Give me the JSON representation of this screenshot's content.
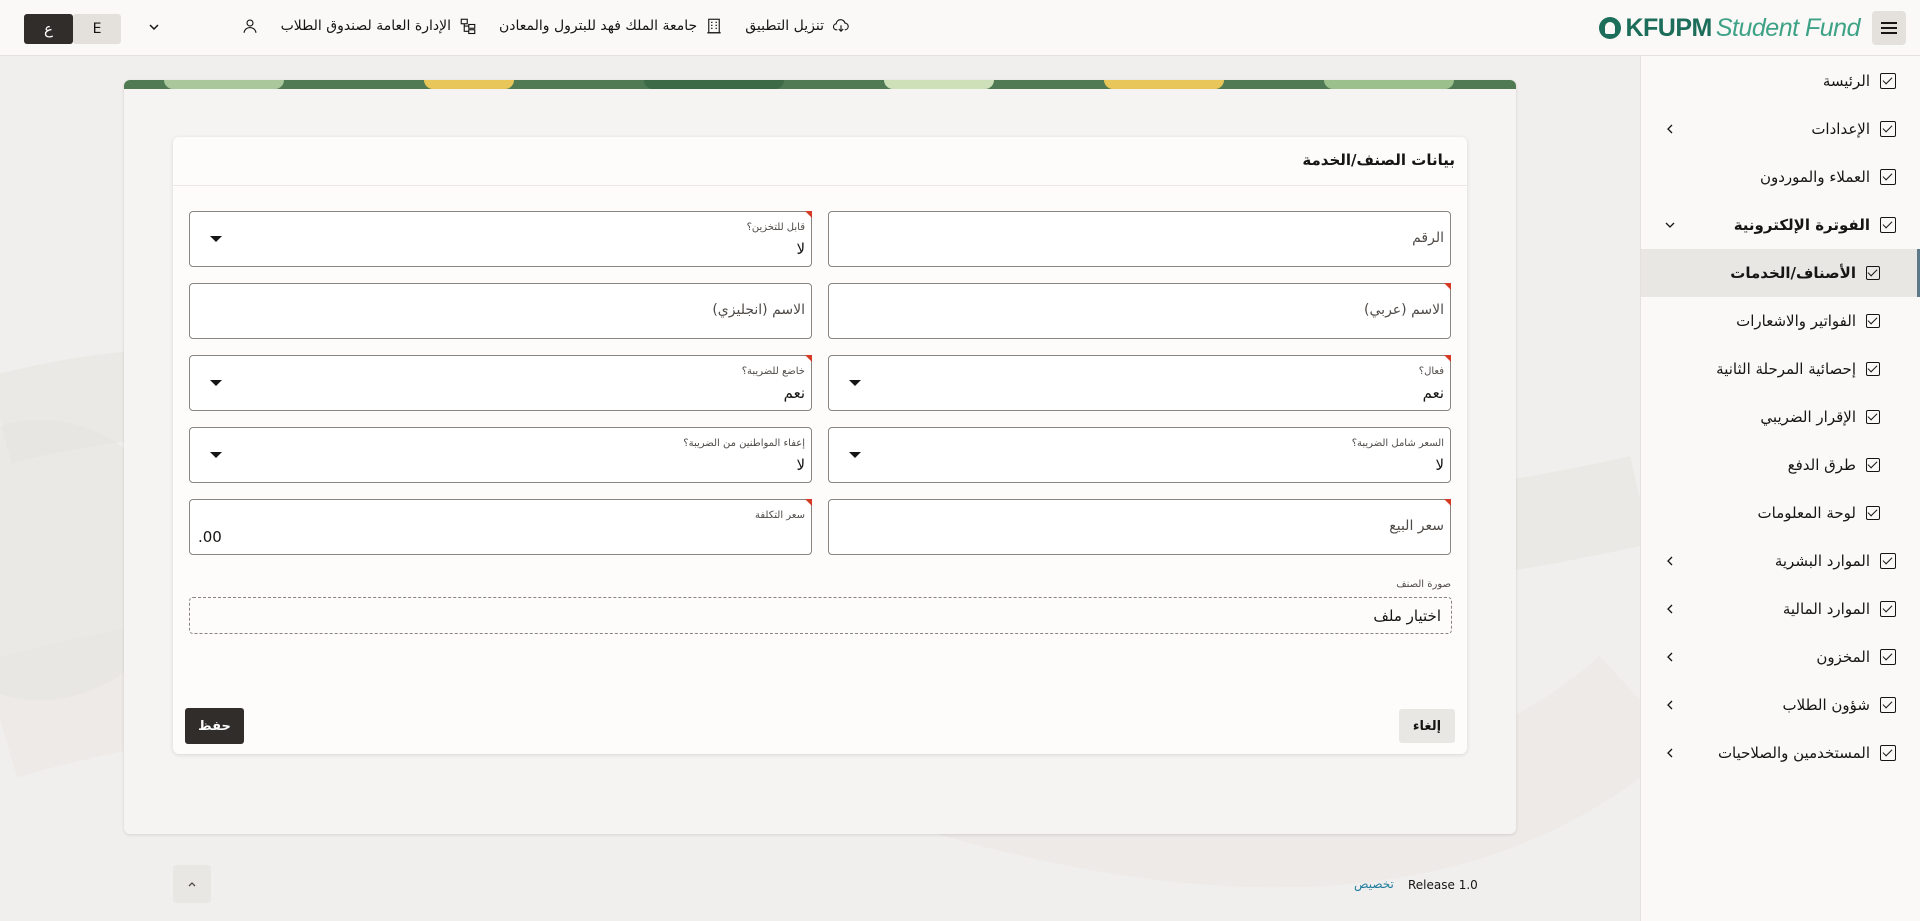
{
  "header": {
    "menu_icon": "hamburger-icon",
    "logo_text_bold": "KFUPM",
    "logo_text_light": "Student Fund",
    "items": [
      {
        "label": "تنزيل التطبيق",
        "icon": "cloud-download-icon"
      },
      {
        "label": "جامعة الملك فهد للبترول والمعادن",
        "icon": "building-icon"
      },
      {
        "label": "الإدارة العامة لصندوق الطلاب",
        "icon": "org-chart-icon"
      }
    ],
    "user_icon": "user-icon",
    "lang_english": "E",
    "lang_arabic": "ع"
  },
  "sidebar": {
    "items": [
      {
        "label": "الرئيسة",
        "sub": false,
        "chevron": false
      },
      {
        "label": "الإعدادات",
        "sub": false,
        "chevron": true
      },
      {
        "label": "العملاء والموردون",
        "sub": false,
        "chevron": false
      },
      {
        "label": "الفوترة الإلكترونية",
        "sub": false,
        "chevron": true,
        "expanded": true
      },
      {
        "label": "الأصناف/الخدمات",
        "sub": true,
        "active": true
      },
      {
        "label": "الفواتير والاشعارات",
        "sub": true
      },
      {
        "label": "إحصائية المرحلة الثانية",
        "sub": true
      },
      {
        "label": "الإقرار الضريبي",
        "sub": true
      },
      {
        "label": "طرق الدفع",
        "sub": true
      },
      {
        "label": "لوحة المعلومات",
        "sub": true
      },
      {
        "label": "الموارد البشرية",
        "sub": false,
        "chevron": true
      },
      {
        "label": "الموارد المالية",
        "sub": false,
        "chevron": true
      },
      {
        "label": "المخزون",
        "sub": false,
        "chevron": true
      },
      {
        "label": "شؤون الطلاب",
        "sub": false,
        "chevron": true
      },
      {
        "label": "المستخدمين والصلاحيات",
        "sub": false,
        "chevron": true
      }
    ]
  },
  "form": {
    "title": "بيانات الصنف/الخدمة",
    "number_placeholder": "الرقم",
    "storable_label": "قابل للتخزين؟",
    "storable_value": "لا",
    "name_ar_placeholder": "الاسم (عربي)",
    "name_en_placeholder": "الاسم (انجليزي)",
    "active_label": "فعال؟",
    "active_value": "نعم",
    "taxable_label": "خاضع للضريبة؟",
    "taxable_value": "نعم",
    "price_incl_tax_label": "السعر شامل الضريبة؟",
    "price_incl_tax_value": "لا",
    "citizen_exempt_label": "إعفاء المواطنين من الضريبة؟",
    "citizen_exempt_value": "لا",
    "sale_price_placeholder": "سعر البيع",
    "cost_price_label": "سعر التكلفة",
    "cost_price_value": ".00",
    "image_label": "صورة الصنف",
    "file_button": "اختيار ملف",
    "cancel_label": "إلغاء",
    "save_label": "حفظ"
  },
  "footer": {
    "release": "Release 1.0",
    "customize": "تخصيص"
  }
}
